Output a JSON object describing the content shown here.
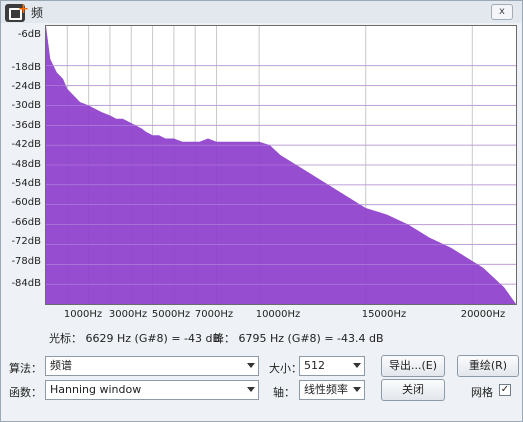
{
  "window": {
    "title": "频",
    "close_label": "x"
  },
  "spectrum": {
    "y_labels": [
      "-6dB",
      "-18dB",
      "-24dB",
      "-30dB",
      "-36dB",
      "-42dB",
      "-48dB",
      "-54dB",
      "-60dB",
      "-66dB",
      "-72dB",
      "-78dB",
      "-84dB"
    ],
    "x_labels": [
      "1000Hz",
      "3000Hz",
      "5000Hz",
      "7000Hz",
      "10000Hz",
      "15000Hz",
      "20000Hz"
    ],
    "fill_color": "#8e3fcc",
    "grid": true
  },
  "chart_data": {
    "type": "area",
    "xlabel": "",
    "ylabel": "",
    "xlim": [
      0,
      22050
    ],
    "ylim": [
      -90,
      -6
    ],
    "x": [
      0,
      200,
      500,
      800,
      1000,
      1300,
      1600,
      2000,
      2300,
      2600,
      3000,
      3300,
      3600,
      3900,
      4200,
      4500,
      4700,
      5000,
      5300,
      5600,
      6000,
      6400,
      6800,
      7200,
      7600,
      8000,
      8500,
      9000,
      9500,
      10000,
      10500,
      11000,
      12000,
      13000,
      14000,
      15000,
      16000,
      17000,
      18000,
      19000,
      20000,
      20500,
      21000,
      21500,
      22050
    ],
    "values": [
      -6,
      -16,
      -20,
      -22,
      -25,
      -27,
      -29,
      -30,
      -31,
      -32,
      -33,
      -34,
      -34,
      -35,
      -36,
      -37,
      -38,
      -39,
      -39,
      -40,
      -40,
      -41,
      -41,
      -41,
      -40,
      -41,
      -41,
      -41,
      -41,
      -41,
      -42,
      -45,
      -49,
      -53,
      -57,
      -61,
      -63,
      -66,
      -70,
      -73,
      -77,
      -79,
      -82,
      -85,
      -90
    ]
  },
  "readout": {
    "cursor": "光标：  6629 Hz (G#8) = -43 dB",
    "peak": "峰：  6795 Hz (G#8) = -43.4 dB"
  },
  "controls": {
    "algorithm_label": "算法：",
    "algorithm_value": "频谱",
    "size_label": "大小：",
    "size_value": "512",
    "export_button": "导出...(E)",
    "replot_button": "重绘(R)",
    "function_label": "函数：",
    "function_value": "Hanning window",
    "axis_label": "轴：",
    "axis_value": "线性频率",
    "close_button": "关闭",
    "grid_label": "网格",
    "grid_checked": "✓"
  }
}
